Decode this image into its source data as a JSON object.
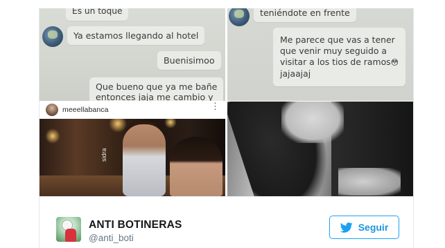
{
  "chat_left": {
    "top_fragment": "Es un toque",
    "msg_1": "Ya estamos llegando al hotel",
    "msg_2": "Buenisimoo",
    "msg_3_line1": "Que bueno que ya me bañe",
    "msg_3_line2": "entonces jaja me cambio y"
  },
  "chat_right": {
    "top_fragment": "teniéndote en frente",
    "msg_line1": "Me parece que vas a tener",
    "msg_line2": "que venir muy seguido a",
    "msg_line3": "visitar a los tios de ramos",
    "msg_emoji": "😳",
    "msg_line4": "jajaajaj"
  },
  "instagram": {
    "username": "meeellabanca",
    "more_icon": "more-vertical-icon",
    "photo_overlay_text": "sidra"
  },
  "author": {
    "name": "ANTI BOTINERAS",
    "handle": "@anti_boti",
    "follow_label": "Seguir",
    "follow_icon": "twitter-bird-icon",
    "accent_color": "#1da1f2"
  }
}
